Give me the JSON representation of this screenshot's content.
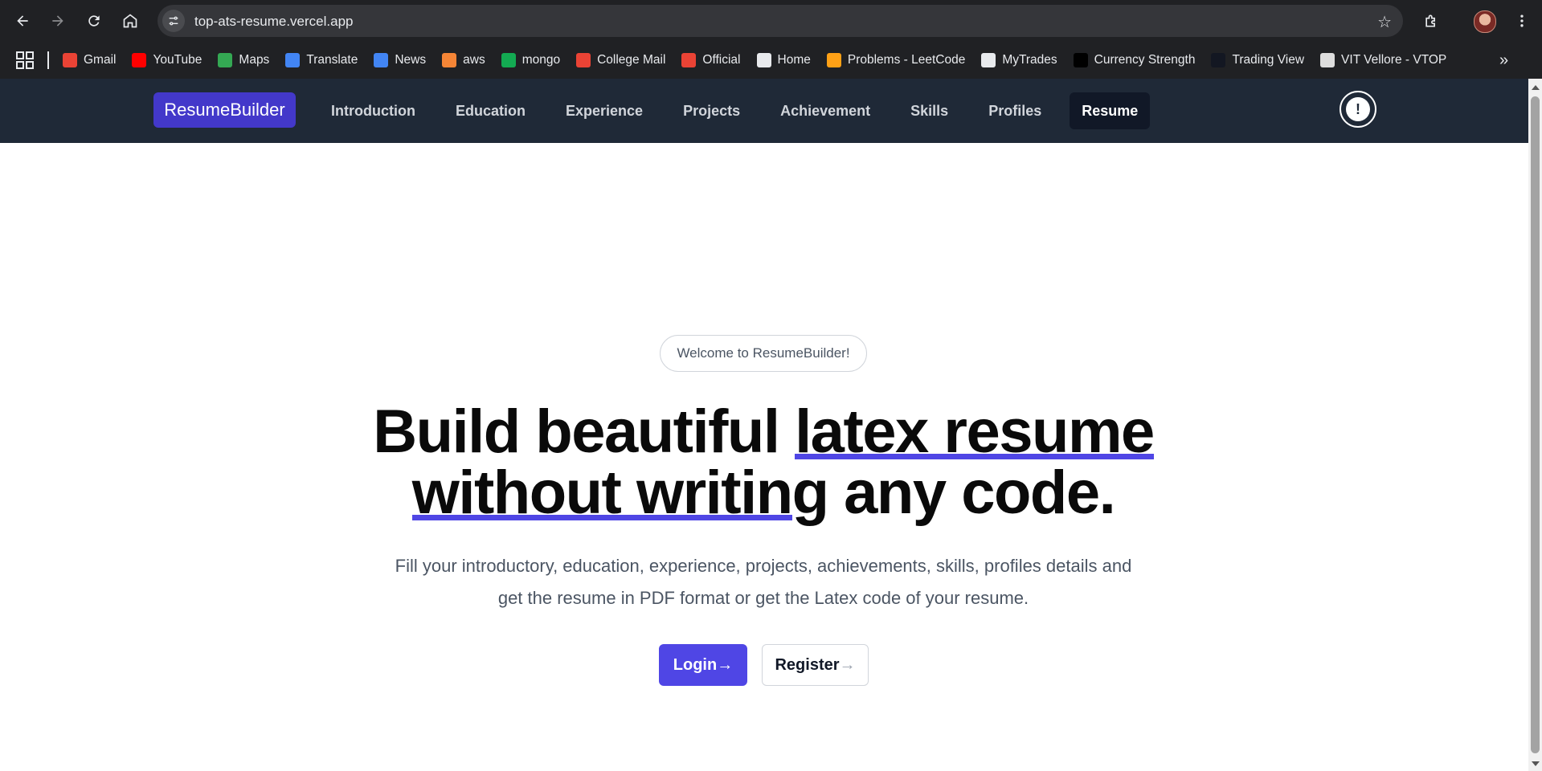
{
  "browser": {
    "url": "top-ats-resume.vercel.app",
    "bookmarks": [
      {
        "label": "Gmail",
        "icon": "gmail-icon",
        "color": "#ea4335"
      },
      {
        "label": "YouTube",
        "icon": "youtube-icon",
        "color": "#ff0000"
      },
      {
        "label": "Maps",
        "icon": "maps-icon",
        "color": "#34a853"
      },
      {
        "label": "Translate",
        "icon": "translate-icon",
        "color": "#4285f4"
      },
      {
        "label": "News",
        "icon": "news-icon",
        "color": "#4285f4"
      },
      {
        "label": "aws",
        "icon": "aws-icon",
        "color": "#f58536"
      },
      {
        "label": "mongo",
        "icon": "mongo-icon",
        "color": "#13aa52"
      },
      {
        "label": "College Mail",
        "icon": "gmail-icon",
        "color": "#ea4335"
      },
      {
        "label": "Official",
        "icon": "gmail-icon",
        "color": "#ea4335"
      },
      {
        "label": "Home",
        "icon": "globe-icon",
        "color": "#e8eaed"
      },
      {
        "label": "Problems - LeetCode",
        "icon": "leetcode-icon",
        "color": "#ffa116"
      },
      {
        "label": "MyTrades",
        "icon": "mytrades-icon",
        "color": "#e8eaed"
      },
      {
        "label": "Currency Strength",
        "icon": "lc-icon",
        "color": "#000000"
      },
      {
        "label": "Trading View",
        "icon": "tradingview-icon",
        "color": "#131722"
      },
      {
        "label": "VIT Vellore - VTOP",
        "icon": "vtop-icon",
        "color": "#dddddd"
      }
    ]
  },
  "navbar": {
    "brand": "ResumeBuilder",
    "items": [
      {
        "label": "Introduction",
        "name": "nav-introduction"
      },
      {
        "label": "Education",
        "name": "nav-education"
      },
      {
        "label": "Experience",
        "name": "nav-experience"
      },
      {
        "label": "Projects",
        "name": "nav-projects"
      },
      {
        "label": "Achievement",
        "name": "nav-achievement"
      },
      {
        "label": "Skills",
        "name": "nav-skills"
      },
      {
        "label": "Profiles",
        "name": "nav-profiles"
      }
    ],
    "active_item": "Resume",
    "info_symbol": "!"
  },
  "hero": {
    "badge": "Welcome to ResumeBuilder!",
    "headline": {
      "part1": "Build beautiful ",
      "highlight1": "latex resume",
      "highlight2": "without writin",
      "part2": "g any code."
    },
    "subtitle_line1": "Fill your introductory, education, experience, projects, achievements, skills, profiles details and",
    "subtitle_line2": "get the resume in PDF format or get the Latex code of your resume.",
    "login_label": "Login",
    "register_label": "Register",
    "arrow": "→"
  },
  "colors": {
    "navbar_bg": "#1f2937",
    "brand_bg": "#4338ca",
    "accent": "#4f46e5"
  }
}
